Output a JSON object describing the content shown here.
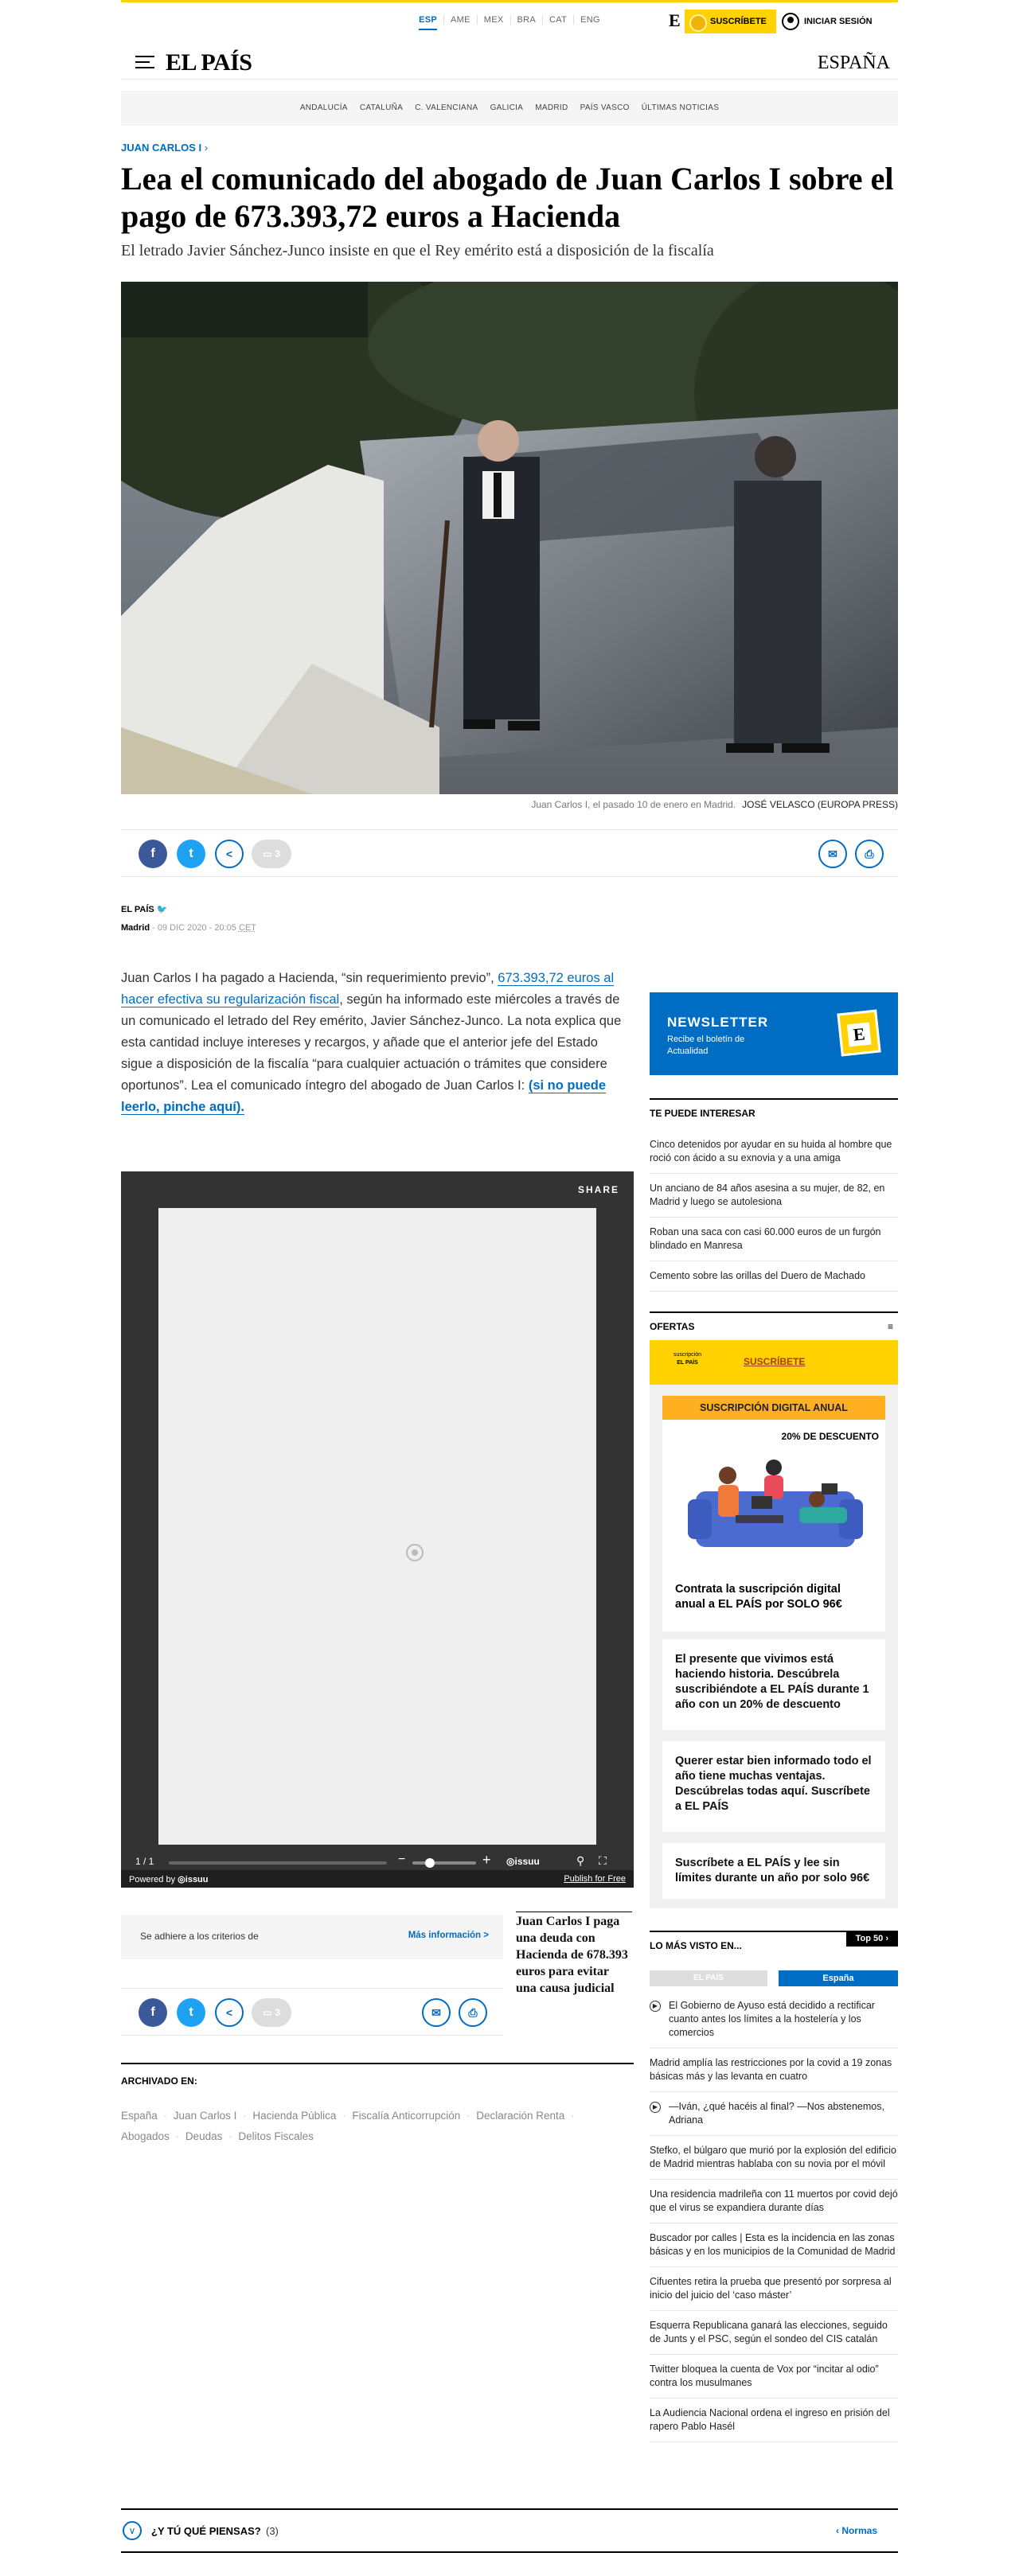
{
  "editions": [
    "ESP",
    "AME",
    "MEX",
    "BRA",
    "CAT",
    "ENG"
  ],
  "header": {
    "subscribe_label": "SUSCRÍBETE",
    "login_label": "INICIAR SESIÓN",
    "logo": "EL PAÍS",
    "region": "ESPAÑA",
    "e_logo": "E"
  },
  "subnav": [
    "ANDALUCÍA",
    "CATALUÑA",
    "C. VALENCIANA",
    "GALICIA",
    "MADRID",
    "PAÍS VASCO",
    "ÚLTIMAS NOTICIAS"
  ],
  "article": {
    "kicker": "JUAN CARLOS I",
    "headline": "Lea el comunicado del abogado de Juan Carlos I sobre el pago de 673.393,72 euros a Hacienda",
    "subheadline": "El letrado Javier Sánchez-Junco insiste en que el Rey emérito está a disposición de la fiscalía",
    "photo_caption": "Juan Carlos I, el pasado 10 de enero en Madrid.",
    "photo_credit": "JOSÉ VELASCO (EUROPA PRESS)",
    "comment_count": "3",
    "author": "EL PAÍS",
    "location": "Madrid",
    "date": "09 DIC 2020 - 20:05",
    "timezone": "CET",
    "body_1": "Juan Carlos I ha pagado a Hacienda, “sin requerimiento previo”, ",
    "body_link": "673.393,72 euros al hacer efectiva su regularización fiscal",
    "body_2": ", según ha informado este miércoles a través de un comunicado el letrado del Rey emérito, Javier Sánchez-Junco. La nota explica que esta cantidad incluye intereses y recargos, y añade que el anterior jefe del Estado sigue a disposición de la fiscalía “para cualquier actuación o trámites que considere oportunos”. Lea el comunicado íntegro del abogado de Juan Carlos I: ",
    "body_link2": "(si no puede leerlo, pinche aquí)."
  },
  "issuu": {
    "share_label": "SHARE",
    "page_counter": "1 / 1",
    "brand": "issuu",
    "powered_by": "Powered by",
    "publish_label": "Publish for Free"
  },
  "criteria": {
    "text": "Se adhiere a los criterios de",
    "more_label": "Más información >"
  },
  "related_title": "Juan Carlos I paga una deuda con Hacienda de 678.393 euros para evitar una causa judicial",
  "archived": {
    "title": "ARCHIVADO EN:",
    "tags": [
      "España",
      "Juan Carlos I",
      "Hacienda Pública",
      "Fiscalía Anticorrupción",
      "Declaración Renta",
      "Abogados",
      "Deudas",
      "Delitos Fiscales"
    ]
  },
  "newsletter": {
    "title": "NEWSLETTER",
    "text": "Recibe el boletín de Actualidad"
  },
  "interesar": {
    "title": "TE PUEDE INTERESAR",
    "items": [
      "Cinco detenidos por ayudar en su huida al hombre que roció con ácido a su exnovia y a una amiga",
      "Un anciano de 84 años asesina a su mujer, de 82, en Madrid y luego se autolesiona",
      "Roban una saca con casi 60.000 euros de un furgón blindado en Manresa",
      "Cemento sobre las orillas del Duero de Machado"
    ]
  },
  "ofertas": {
    "title": "OFERTAS",
    "subscribe_label": "SUSCRÍBETE",
    "mini_logo": "EL PAÍS",
    "mini_logo_sub": "suscripción",
    "promo_title": "SUSCRIPCIÓN DIGITAL ANUAL",
    "promo_badge": "20% DE DESCUENTO",
    "cards": [
      "Contrata la suscripción digital anual a EL PAÍS por SOLO 96€",
      "El presente que vivimos está haciendo historia. Descúbrela suscribiéndote a EL PAÍS durante 1 año con un 20% de descuento",
      "Querer estar bien informado todo el año tiene muchas ventajas. Descúbrelas todas aquí. Suscríbete a EL PAÍS",
      "Suscríbete a EL PAÍS y lee sin límites durante un año por solo 96€"
    ]
  },
  "mas_visto": {
    "title": "LO MÁS VISTO EN...",
    "top_label": "Top 50",
    "tab_global": "EL PAÍS",
    "tab_spain": "España",
    "items": [
      "El Gobierno de Ayuso está decidido a rectificar cuanto antes los límites a la hostelería y los comercios",
      "Madrid amplía las restricciones por la covid a 19 zonas básicas más y las levanta en cuatro",
      "—Iván, ¿qué hacéis al final? —Nos abstenemos, Adriana",
      "Stefko, el búlgaro que murió por la explosión del edificio de Madrid mientras hablaba con su novia por el móvil",
      "Una residencia madrileña con 11 muertos por covid dejó que el virus se expandiera durante días",
      "Buscador por calles | Esta es la incidencia en las zonas básicas y en los municipios de la Comunidad de Madrid",
      "Cifuentes retira la prueba que presentó por sorpresa al inicio del juicio del ‘caso máster’",
      "Esquerra Republicana ganará las elecciones, seguido de Junts y el PSC, según el sondeo del CIS catalán",
      "Twitter bloquea la cuenta de Vox por “incitar al odio” contra los musulmanes",
      "La Audiencia Nacional ordena el ingreso en prisión del rapero Pablo Hasél"
    ]
  },
  "comments": {
    "label": "¿Y TÚ QUÉ PIENSAS?",
    "count": "(3)",
    "rules_label": "Normas"
  }
}
